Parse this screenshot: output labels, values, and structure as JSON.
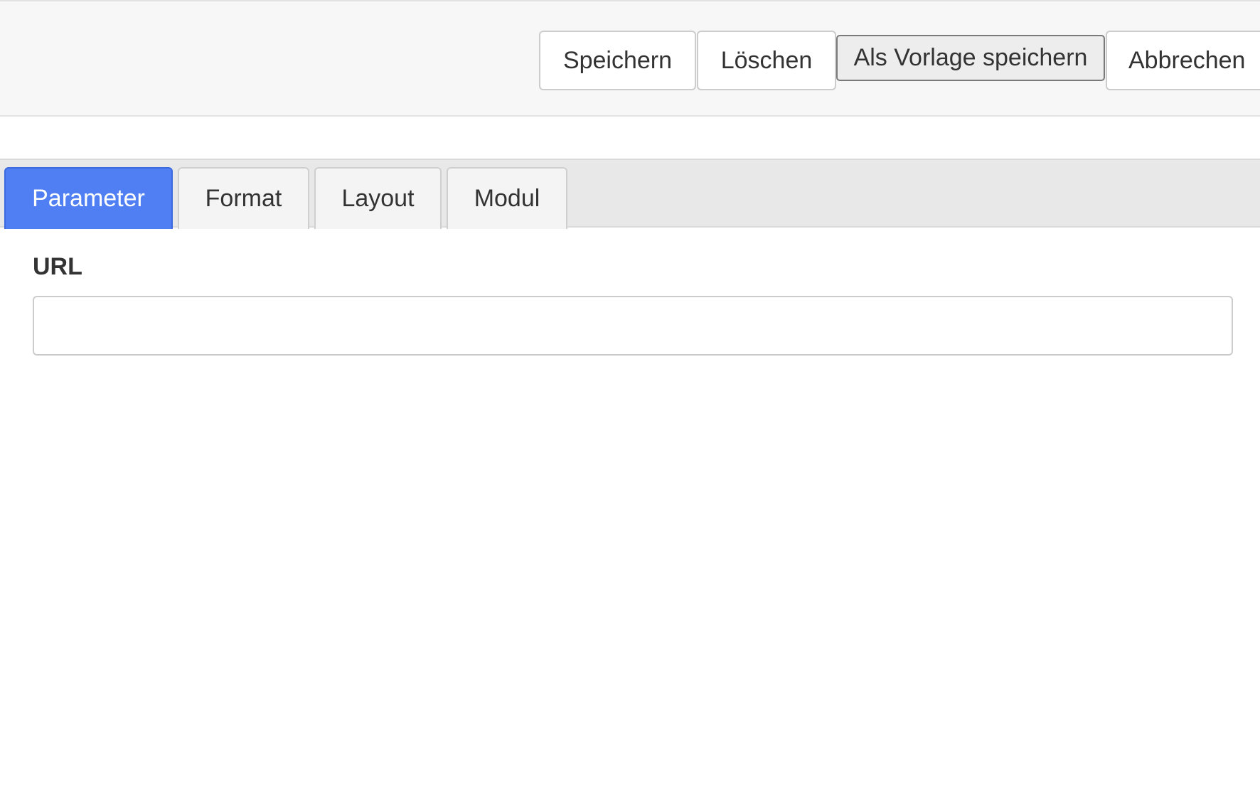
{
  "toolbar": {
    "save_label": "Speichern",
    "delete_label": "Löschen",
    "save_as_template_label": "Als Vorlage speichern",
    "cancel_label": "Abbrechen"
  },
  "tabs": {
    "active": "Parameter",
    "items": [
      {
        "label": "Parameter"
      },
      {
        "label": "Format"
      },
      {
        "label": "Layout"
      },
      {
        "label": "Modul"
      }
    ]
  },
  "form": {
    "url": {
      "label": "URL",
      "value": "",
      "placeholder": ""
    }
  },
  "colors": {
    "active_tab": "#4f7ff2",
    "toolbar_background": "#f7f7f7",
    "tabbar_background": "#e8e8e8"
  }
}
